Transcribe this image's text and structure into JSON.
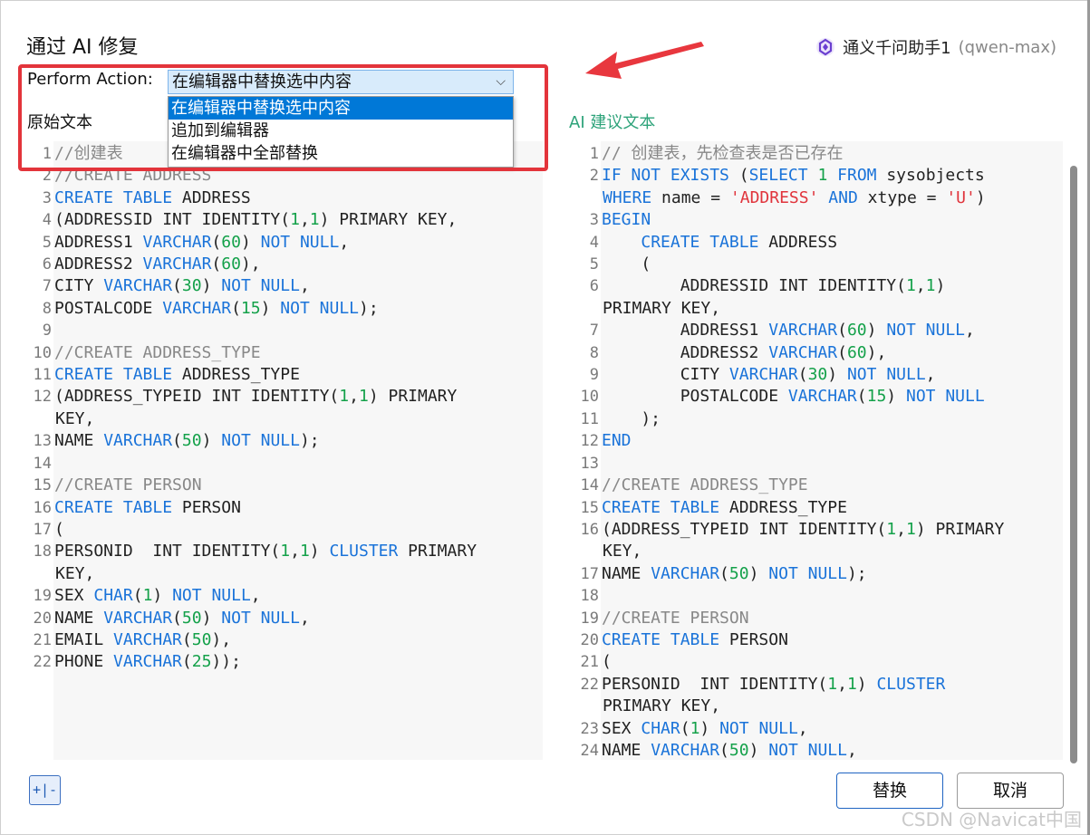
{
  "dialog": {
    "title": "通过 AI 修复"
  },
  "assistant": {
    "name": "通义千问助手1",
    "model": "(qwen-max)",
    "icon": "assistant-logo-icon"
  },
  "action": {
    "label": "Perform Action:",
    "selected": "在编辑器中替换选中内容",
    "options": [
      "在编辑器中替换选中内容",
      "追加到编辑器",
      "在编辑器中全部替换"
    ]
  },
  "panels": {
    "original_label": "原始文本",
    "ai_label": "AI 建议文本"
  },
  "buttons": {
    "toggle": "+|-",
    "replace": "替换",
    "cancel": "取消"
  },
  "colors": {
    "keyword": "#1a73d9",
    "number": "#14a14a",
    "comment": "#888888",
    "string": "#e0343c",
    "highlight_box": "#e3343b",
    "ai_label": "#2ea37a"
  },
  "watermark": "CSDN @Navicat中国",
  "left_code": [
    {
      "n": "1",
      "t": [
        [
          "cm",
          "//创建表"
        ]
      ]
    },
    {
      "n": "2",
      "t": [
        [
          "cm",
          "//CREATE ADDRESS"
        ]
      ]
    },
    {
      "n": "3",
      "t": [
        [
          "kw",
          "CREATE TABLE"
        ],
        [
          "",
          "ADDRESS"
        ]
      ]
    },
    {
      "n": "4",
      "t": [
        [
          "",
          "(ADDRESSID INT IDENTITY("
        ],
        [
          "nl",
          "1"
        ],
        [
          "",
          ","
        ],
        [
          "nl",
          "1"
        ],
        [
          "",
          ") PRIMARY KEY,"
        ]
      ]
    },
    {
      "n": "5",
      "t": [
        [
          "",
          "ADDRESS1 "
        ],
        [
          "kw",
          "VARCHAR"
        ],
        [
          "",
          "("
        ],
        [
          "nl",
          "60"
        ],
        [
          "",
          ") "
        ],
        [
          "kw",
          "NOT NULL"
        ],
        [
          "",
          ","
        ]
      ]
    },
    {
      "n": "6",
      "t": [
        [
          "",
          "ADDRESS2 "
        ],
        [
          "kw",
          "VARCHAR"
        ],
        [
          "",
          "("
        ],
        [
          "nl",
          "60"
        ],
        [
          "",
          "),"
        ]
      ]
    },
    {
      "n": "7",
      "t": [
        [
          "",
          "CITY "
        ],
        [
          "kw",
          "VARCHAR"
        ],
        [
          "",
          "("
        ],
        [
          "nl",
          "30"
        ],
        [
          "",
          ") "
        ],
        [
          "kw",
          "NOT NULL"
        ],
        [
          "",
          ","
        ]
      ]
    },
    {
      "n": "8",
      "t": [
        [
          "",
          "POSTALCODE "
        ],
        [
          "kw",
          "VARCHAR"
        ],
        [
          "",
          "("
        ],
        [
          "nl",
          "15"
        ],
        [
          "",
          ") "
        ],
        [
          "kw",
          "NOT NULL"
        ],
        [
          "",
          ");"
        ]
      ]
    },
    {
      "n": "9",
      "t": []
    },
    {
      "n": "10",
      "t": [
        [
          "cm",
          "//CREATE ADDRESS_TYPE"
        ]
      ]
    },
    {
      "n": "11",
      "t": [
        [
          "kw",
          "CREATE TABLE"
        ],
        [
          "",
          "ADDRESS_TYPE"
        ]
      ]
    },
    {
      "n": "12",
      "t": [
        [
          "",
          "(ADDRESS_TYPEID INT IDENTITY("
        ],
        [
          "nl",
          "1"
        ],
        [
          "",
          ","
        ],
        [
          "nl",
          "1"
        ],
        [
          "",
          ") PRIMARY"
        ]
      ]
    },
    {
      "n": "",
      "t": [
        [
          "",
          "KEY,"
        ]
      ],
      "c": true
    },
    {
      "n": "13",
      "t": [
        [
          "",
          "NAME "
        ],
        [
          "kw",
          "VARCHAR"
        ],
        [
          "",
          "("
        ],
        [
          "nl",
          "50"
        ],
        [
          "",
          ") "
        ],
        [
          "kw",
          "NOT NULL"
        ],
        [
          "",
          ");"
        ]
      ]
    },
    {
      "n": "14",
      "t": []
    },
    {
      "n": "15",
      "t": [
        [
          "cm",
          "//CREATE PERSON"
        ]
      ]
    },
    {
      "n": "16",
      "t": [
        [
          "kw",
          "CREATE TABLE"
        ],
        [
          "",
          "PERSON"
        ]
      ]
    },
    {
      "n": "17",
      "t": [
        [
          "",
          "("
        ]
      ]
    },
    {
      "n": "18",
      "t": [
        [
          "",
          "PERSONID  INT IDENTITY("
        ],
        [
          "nl",
          "1"
        ],
        [
          "",
          ","
        ],
        [
          "nl",
          "1"
        ],
        [
          "",
          ") "
        ],
        [
          "kw",
          "CLUSTER"
        ],
        [
          "",
          ""
        ],
        [
          "",
          "PRIMARY"
        ]
      ]
    },
    {
      "n": "",
      "t": [
        [
          "",
          "KEY,"
        ]
      ],
      "c": true
    },
    {
      "n": "19",
      "t": [
        [
          "",
          "SEX "
        ],
        [
          "kw",
          "CHAR"
        ],
        [
          "",
          "("
        ],
        [
          "nl",
          "1"
        ],
        [
          "",
          ") "
        ],
        [
          "kw",
          "NOT NULL"
        ],
        [
          "",
          ","
        ]
      ]
    },
    {
      "n": "20",
      "t": [
        [
          "",
          "NAME "
        ],
        [
          "kw",
          "VARCHAR"
        ],
        [
          "",
          "("
        ],
        [
          "nl",
          "50"
        ],
        [
          "",
          ") "
        ],
        [
          "kw",
          "NOT NULL"
        ],
        [
          "",
          ","
        ]
      ]
    },
    {
      "n": "21",
      "t": [
        [
          "",
          "EMAIL "
        ],
        [
          "kw",
          "VARCHAR"
        ],
        [
          "",
          "("
        ],
        [
          "nl",
          "50"
        ],
        [
          "",
          "),"
        ]
      ]
    },
    {
      "n": "22",
      "t": [
        [
          "",
          "PHONE "
        ],
        [
          "kw",
          "VARCHAR"
        ],
        [
          "",
          "("
        ],
        [
          "nl",
          "25"
        ],
        [
          "",
          "));"
        ]
      ]
    }
  ],
  "right_code": [
    {
      "n": "1",
      "t": [
        [
          "cm",
          "// 创建表，先检查表是否已存在"
        ]
      ]
    },
    {
      "n": "2",
      "t": [
        [
          "kw",
          "IF NOT EXISTS"
        ],
        [
          "",
          ""
        ],
        [
          "",
          "("
        ],
        [
          "kw",
          "SELECT"
        ],
        [
          "",
          ""
        ],
        [
          "nl",
          "1"
        ],
        [
          "",
          ""
        ],
        [
          "kw",
          "FROM"
        ],
        [
          "",
          ""
        ],
        [
          "",
          "sysobjects"
        ]
      ]
    },
    {
      "n": "",
      "t": [
        [
          "kw",
          "WHERE"
        ],
        [
          "",
          ""
        ],
        [
          "",
          "name = "
        ],
        [
          "str",
          "'ADDRESS'"
        ],
        [
          "",
          ""
        ],
        [
          "kw",
          "AND"
        ],
        [
          "",
          ""
        ],
        [
          "",
          "xtype = "
        ],
        [
          "str",
          "'U'"
        ],
        [
          "",
          ")"
        ]
      ],
      "c": true
    },
    {
      "n": "3",
      "t": [
        [
          "kw",
          "BEGIN"
        ]
      ]
    },
    {
      "n": "4",
      "t": [
        [
          "",
          "    "
        ],
        [
          "kw",
          "CREATE TABLE"
        ],
        [
          "",
          ""
        ],
        [
          "",
          "ADDRESS"
        ]
      ]
    },
    {
      "n": "5",
      "t": [
        [
          "",
          "    ("
        ]
      ]
    },
    {
      "n": "6",
      "t": [
        [
          "",
          "        ADDRESSID INT IDENTITY("
        ],
        [
          "nl",
          "1"
        ],
        [
          "",
          ","
        ],
        [
          "nl",
          "1"
        ],
        [
          "",
          ")"
        ]
      ]
    },
    {
      "n": "",
      "t": [
        [
          "",
          "PRIMARY KEY,"
        ]
      ],
      "c": true
    },
    {
      "n": "7",
      "t": [
        [
          "",
          "        ADDRESS1 "
        ],
        [
          "kw",
          "VARCHAR"
        ],
        [
          "",
          "("
        ],
        [
          "nl",
          "60"
        ],
        [
          "",
          ") "
        ],
        [
          "kw",
          "NOT NULL"
        ],
        [
          "",
          ","
        ]
      ]
    },
    {
      "n": "8",
      "t": [
        [
          "",
          "        ADDRESS2 "
        ],
        [
          "kw",
          "VARCHAR"
        ],
        [
          "",
          "("
        ],
        [
          "nl",
          "60"
        ],
        [
          "",
          "),"
        ]
      ]
    },
    {
      "n": "9",
      "t": [
        [
          "",
          "        CITY "
        ],
        [
          "kw",
          "VARCHAR"
        ],
        [
          "",
          "("
        ],
        [
          "nl",
          "30"
        ],
        [
          "",
          ") "
        ],
        [
          "kw",
          "NOT NULL"
        ],
        [
          "",
          ","
        ]
      ]
    },
    {
      "n": "10",
      "t": [
        [
          "",
          "        POSTALCODE "
        ],
        [
          "kw",
          "VARCHAR"
        ],
        [
          "",
          "("
        ],
        [
          "nl",
          "15"
        ],
        [
          "",
          ") "
        ],
        [
          "kw",
          "NOT NULL"
        ]
      ]
    },
    {
      "n": "11",
      "t": [
        [
          "",
          "    );"
        ]
      ]
    },
    {
      "n": "12",
      "t": [
        [
          "kw",
          "END"
        ]
      ]
    },
    {
      "n": "13",
      "t": []
    },
    {
      "n": "14",
      "t": [
        [
          "cm",
          "//CREATE ADDRESS_TYPE"
        ]
      ]
    },
    {
      "n": "15",
      "t": [
        [
          "kw",
          "CREATE TABLE"
        ],
        [
          "",
          ""
        ],
        [
          "",
          "ADDRESS_TYPE"
        ]
      ]
    },
    {
      "n": "16",
      "t": [
        [
          "",
          "(ADDRESS_TYPEID INT IDENTITY("
        ],
        [
          "nl",
          "1"
        ],
        [
          "",
          ","
        ],
        [
          "nl",
          "1"
        ],
        [
          "",
          ") PRIMARY"
        ]
      ]
    },
    {
      "n": "",
      "t": [
        [
          "",
          "KEY,"
        ]
      ],
      "c": true
    },
    {
      "n": "17",
      "t": [
        [
          "",
          "NAME "
        ],
        [
          "kw",
          "VARCHAR"
        ],
        [
          "",
          "("
        ],
        [
          "nl",
          "50"
        ],
        [
          "",
          ") "
        ],
        [
          "kw",
          "NOT NULL"
        ],
        [
          "",
          ");"
        ]
      ]
    },
    {
      "n": "18",
      "t": []
    },
    {
      "n": "19",
      "t": [
        [
          "cm",
          "//CREATE PERSON"
        ]
      ]
    },
    {
      "n": "20",
      "t": [
        [
          "kw",
          "CREATE TABLE"
        ],
        [
          "",
          ""
        ],
        [
          "",
          "PERSON"
        ]
      ]
    },
    {
      "n": "21",
      "t": [
        [
          "",
          "("
        ]
      ]
    },
    {
      "n": "22",
      "t": [
        [
          "",
          "PERSONID  INT IDENTITY("
        ],
        [
          "nl",
          "1"
        ],
        [
          "",
          ","
        ],
        [
          "nl",
          "1"
        ],
        [
          "",
          ") "
        ],
        [
          "kw",
          "CLUSTER"
        ]
      ]
    },
    {
      "n": "",
      "t": [
        [
          "",
          "PRIMARY KEY,"
        ]
      ],
      "c": true
    },
    {
      "n": "23",
      "t": [
        [
          "",
          "SEX "
        ],
        [
          "kw",
          "CHAR"
        ],
        [
          "",
          "("
        ],
        [
          "nl",
          "1"
        ],
        [
          "",
          ") "
        ],
        [
          "kw",
          "NOT NULL"
        ],
        [
          "",
          ","
        ]
      ]
    },
    {
      "n": "24",
      "t": [
        [
          "",
          "NAME "
        ],
        [
          "kw",
          "VARCHAR"
        ],
        [
          "",
          "("
        ],
        [
          "nl",
          "50"
        ],
        [
          "",
          ") "
        ],
        [
          "kw",
          "NOT NULL"
        ],
        [
          "",
          ","
        ]
      ]
    }
  ]
}
